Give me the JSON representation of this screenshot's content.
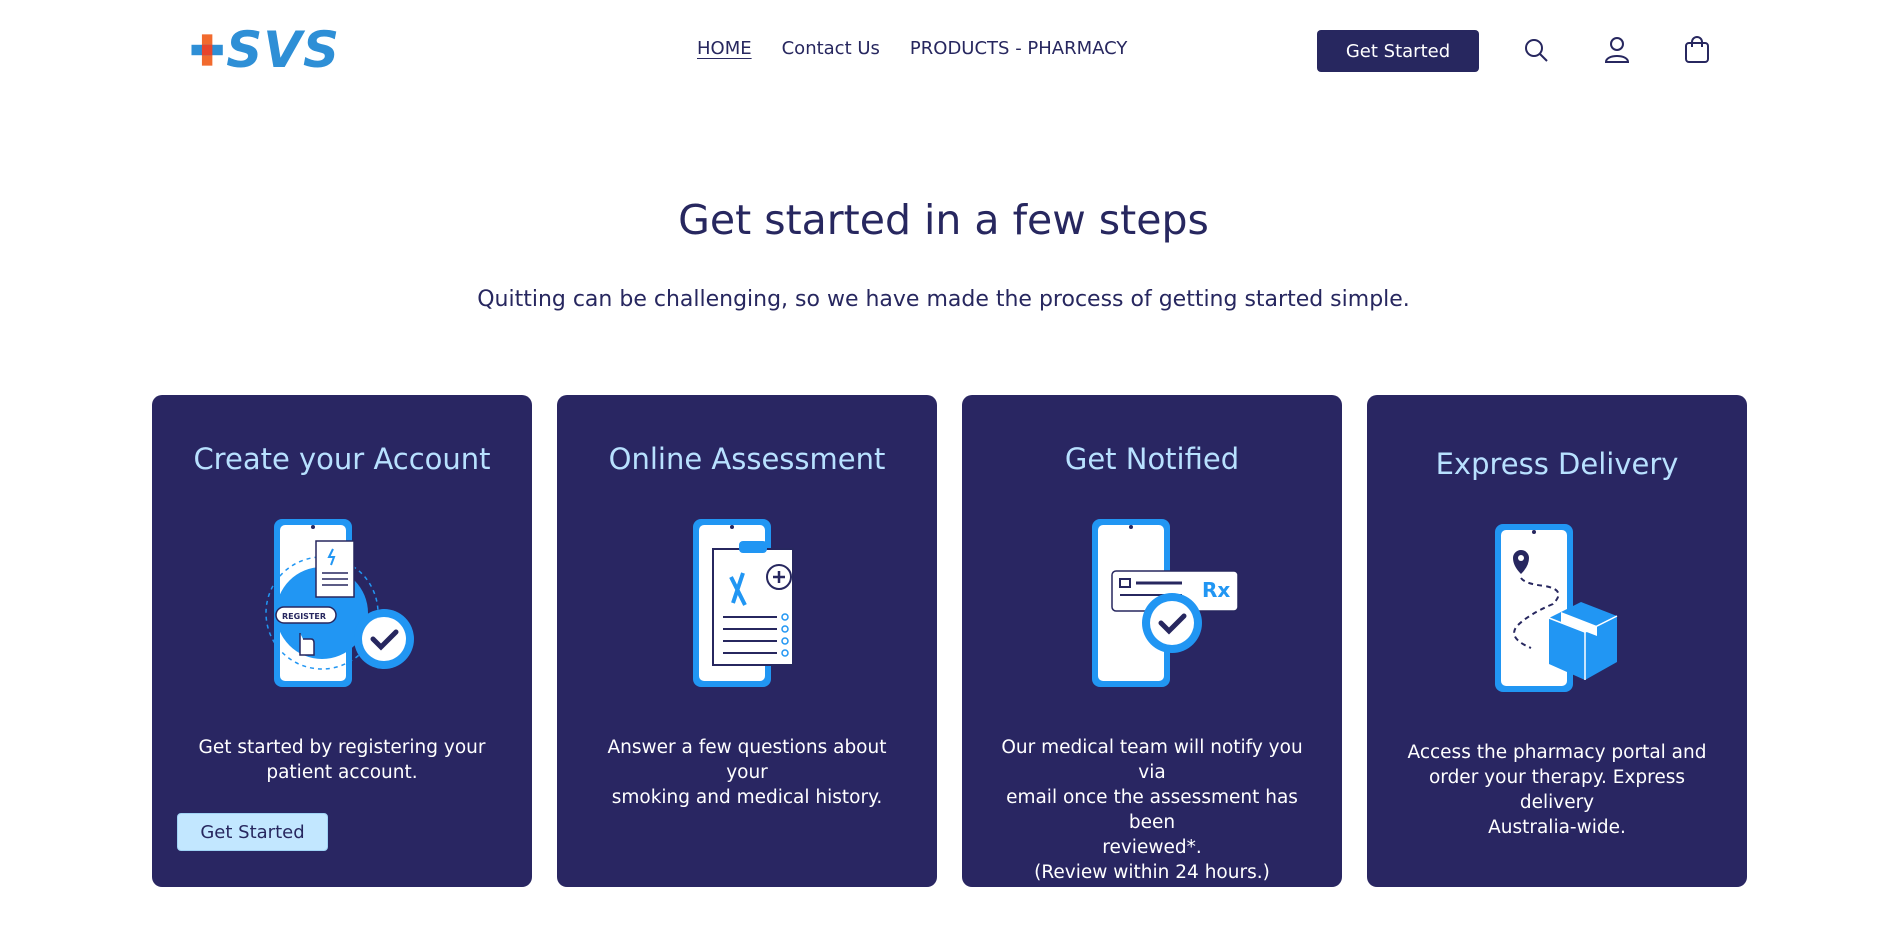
{
  "header": {
    "logo_text": "SVS",
    "nav": [
      "HOME",
      "Contact Us",
      "PRODUCTS - PHARMACY"
    ],
    "cta_label": "Get Started",
    "icons": [
      "search-icon",
      "account-icon",
      "cart-icon"
    ]
  },
  "hero": {
    "title": "Get started in a few steps",
    "subtitle": "Quitting can be challenging, so we have made the process of getting started simple."
  },
  "steps": [
    {
      "title": "Create your Account",
      "text": "Get started by registering your\npatient account.",
      "button_label": "Get Started",
      "illustration": "register-phone-icon",
      "badge_text": "REGISTER"
    },
    {
      "title": "Online Assessment",
      "text": "Answer a few questions about your\nsmoking and medical history.",
      "illustration": "clipboard-phone-icon"
    },
    {
      "title": "Get Notified",
      "text": "Our medical team will notify you via\nemail once the assessment has been\nreviewed*.\n(Review within 24 hours.)",
      "illustration": "prescription-notify-icon",
      "badge_text": "Rx"
    },
    {
      "title": "Express Delivery",
      "text": "Access the pharmacy portal and\norder your therapy. Express delivery\nAustralia-wide.",
      "illustration": "delivery-phone-icon"
    }
  ],
  "colors": {
    "navy": "#27275f",
    "card_bg": "#292662",
    "card_title": "#b8e1ff",
    "button_light": "#c2e7ff",
    "accent_blue": "#2196f3",
    "logo_orange": "#f26a2e",
    "logo_blue": "#2e8fd6"
  }
}
